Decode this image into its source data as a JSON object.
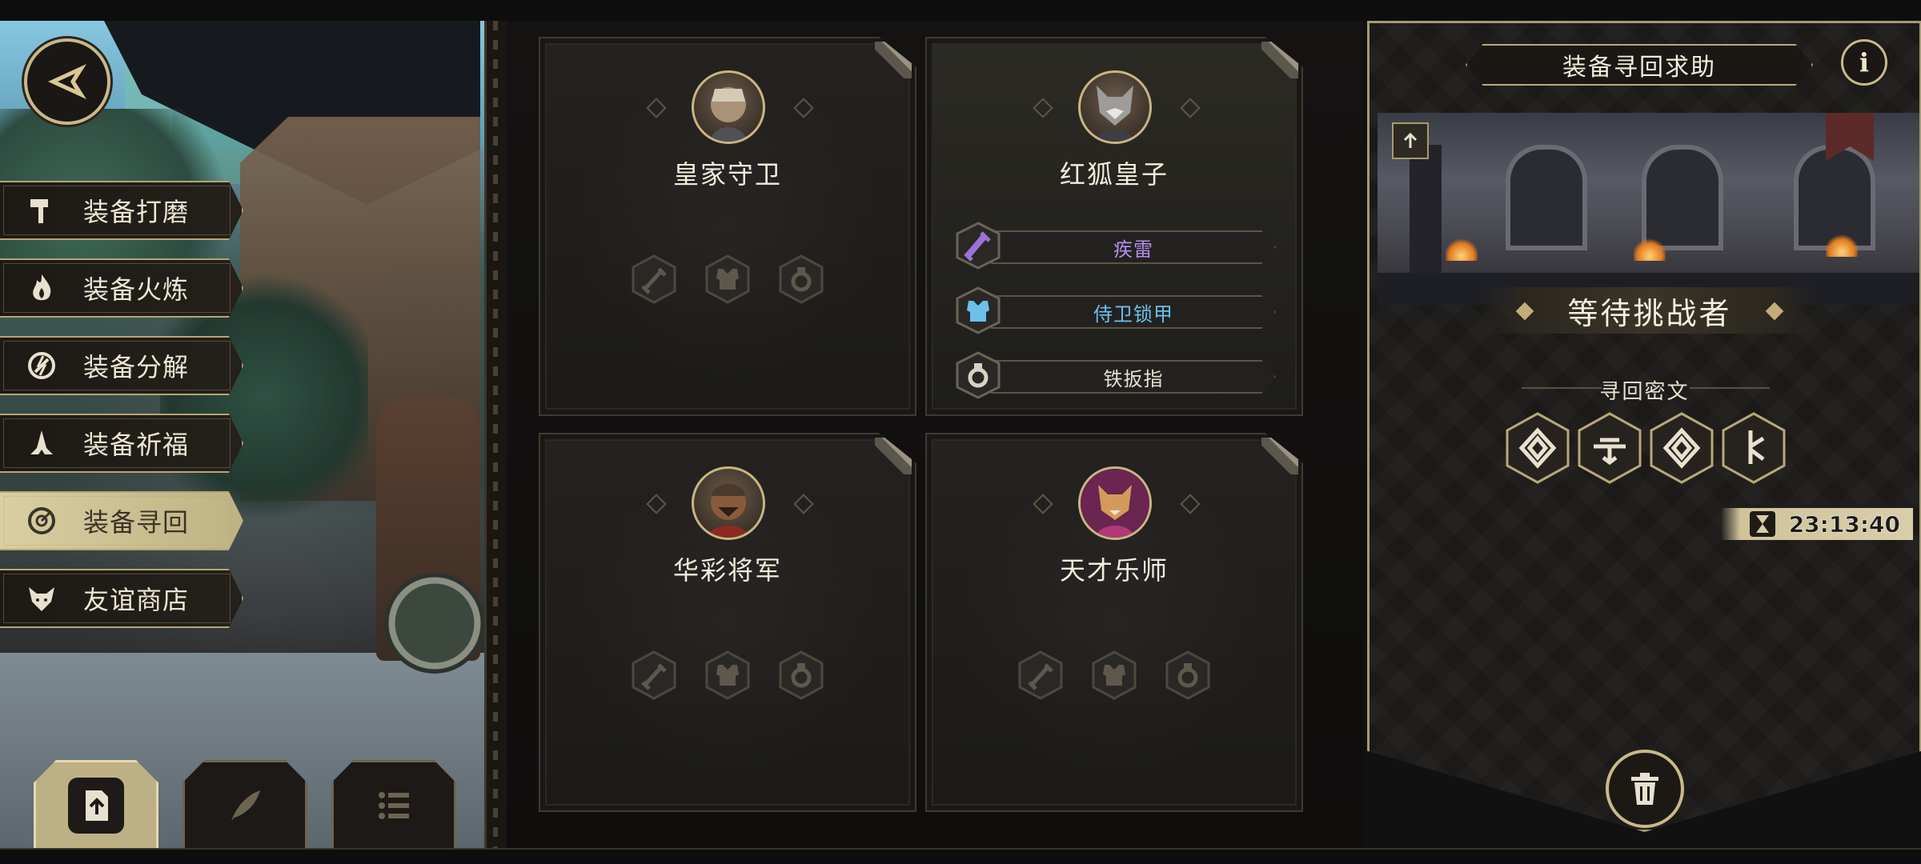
{
  "menu": {
    "items": [
      {
        "label": "装备打磨",
        "icon": "hammer-icon",
        "active": false
      },
      {
        "label": "装备火炼",
        "icon": "flame-icon",
        "active": false
      },
      {
        "label": "装备分解",
        "icon": "decompose-icon",
        "active": false
      },
      {
        "label": "装备祈福",
        "icon": "pray-icon",
        "active": false
      },
      {
        "label": "装备寻回",
        "icon": "recover-icon",
        "active": true
      },
      {
        "label": "友谊商店",
        "icon": "fox-icon",
        "active": false
      }
    ]
  },
  "bottom_buttons": [
    {
      "icon": "upload-icon",
      "active": true
    },
    {
      "icon": "quill-icon",
      "active": false
    },
    {
      "icon": "list-icon",
      "active": false
    }
  ],
  "cards": [
    {
      "name": "皇家守卫",
      "has_equipment": false
    },
    {
      "name": "红狐皇子",
      "has_equipment": true,
      "equipment": [
        {
          "name": "疾雷",
          "icon": "sword-icon",
          "color": "#b58ee6"
        },
        {
          "name": "侍卫锁甲",
          "icon": "armor-icon",
          "color": "#6cc0ea"
        },
        {
          "name": "铁扳指",
          "icon": "ring-icon",
          "color": "#e8e1cf"
        }
      ]
    },
    {
      "name": "华彩将军",
      "has_equipment": false
    },
    {
      "name": "天才乐师",
      "has_equipment": false
    }
  ],
  "right_panel": {
    "title": "装备寻回求助",
    "info_label": "i",
    "status": "等待挑战者",
    "cipher_title": "寻回密文",
    "runes": [
      "rune-spiral-icon",
      "rune-cross-icon",
      "rune-spiral-icon",
      "rune-branch-icon"
    ],
    "timer": "23:13:40"
  },
  "colors": {
    "gold": "#c9b98a",
    "epic": "#b58ee6",
    "rare": "#6cc0ea"
  }
}
